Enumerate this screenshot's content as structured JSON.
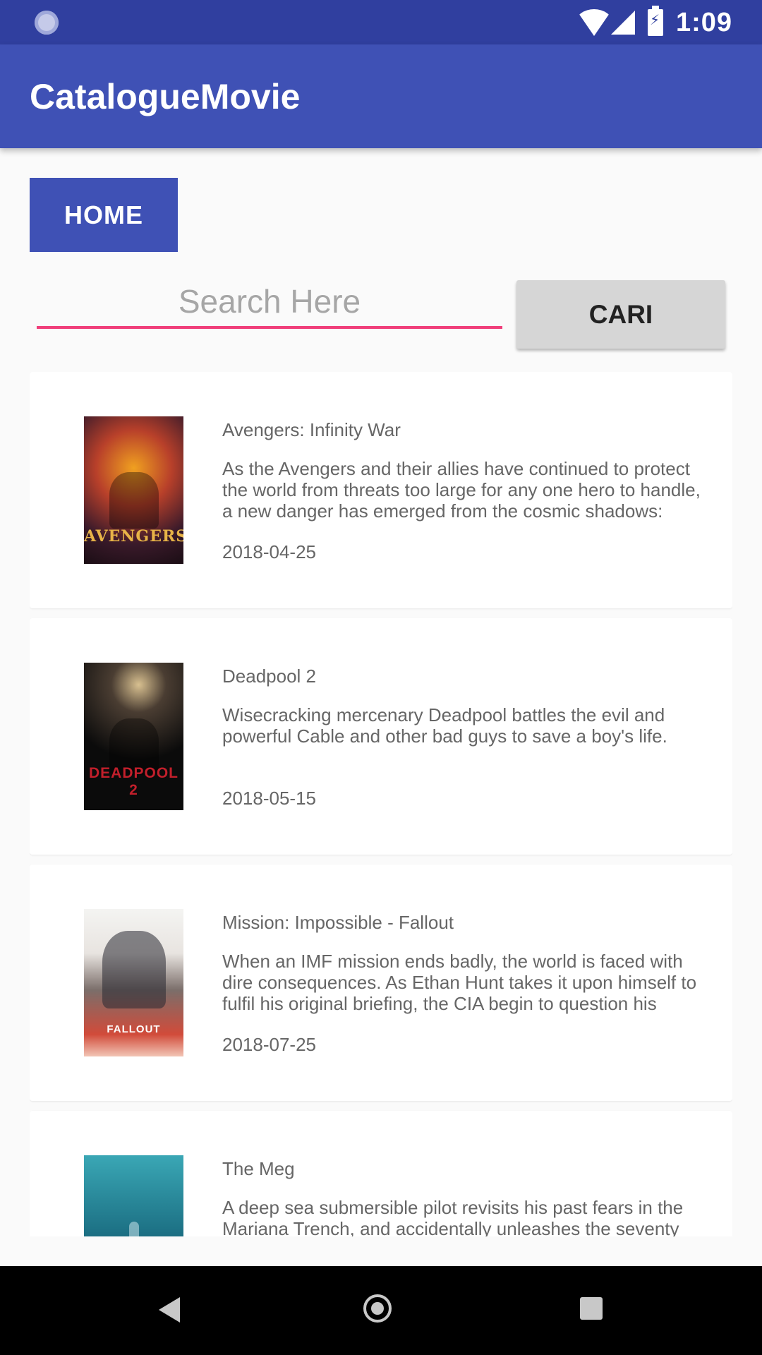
{
  "status_bar": {
    "time": "1:09",
    "icons": [
      "loading-icon",
      "wifi-icon",
      "signal-icon",
      "battery-charging-icon"
    ]
  },
  "app_bar": {
    "title": "CatalogueMovie"
  },
  "home_button": {
    "label": "HOME"
  },
  "search": {
    "placeholder": "Search Here",
    "value": "",
    "button_label": "CARI"
  },
  "colors": {
    "primary": "#3f51b5",
    "primary_dark": "#303f9f",
    "accent": "#f03e7a",
    "button_gray": "#d6d6d6"
  },
  "movies": [
    {
      "title": "Avengers: Infinity War",
      "overview": "As the Avengers and their allies have continued to protect the world from threats too large for any one hero to handle, a new danger has emerged from the cosmic shadows:",
      "release_date": "2018-04-25",
      "poster_caption": "AVENGERS"
    },
    {
      "title": "Deadpool 2",
      "overview": "Wisecracking mercenary Deadpool battles the evil and powerful Cable and other bad guys to save a boy's life.",
      "release_date": "2018-05-15",
      "poster_caption": "DEADPOOL 2"
    },
    {
      "title": "Mission: Impossible - Fallout",
      "overview": "When an IMF mission ends badly, the world is faced with dire consequences. As Ethan Hunt takes it upon himself to fulfil his original briefing, the CIA begin to question his",
      "release_date": "2018-07-25",
      "poster_caption": "FALLOUT"
    },
    {
      "title": "The Meg",
      "overview": "A deep sea submersible pilot revisits his past fears in the Mariana Trench, and accidentally unleashes the seventy",
      "release_date": "",
      "poster_caption": ""
    }
  ],
  "nav_bar": {
    "icons": [
      "back-icon",
      "home-icon",
      "recents-icon"
    ]
  }
}
